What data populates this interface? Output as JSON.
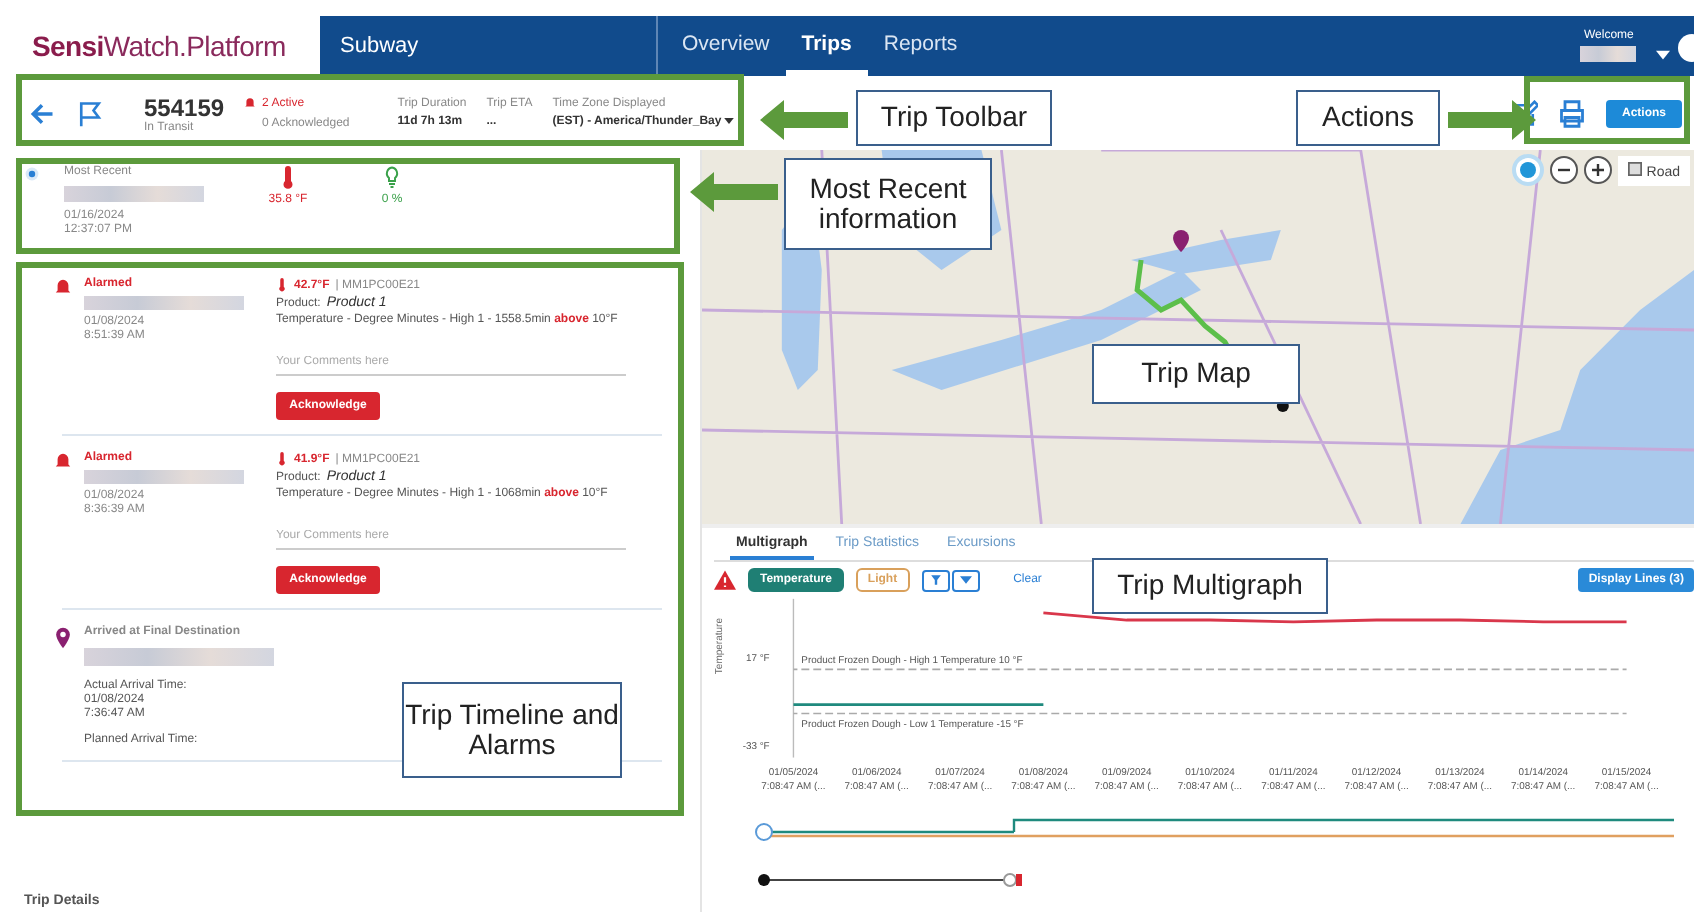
{
  "header": {
    "logo_bold": "Sensi",
    "logo_rest": "Watch.Platform",
    "account": "Subway",
    "nav": [
      {
        "label": "Overview",
        "selected": false
      },
      {
        "label": "Trips",
        "selected": true
      },
      {
        "label": "Reports",
        "selected": false
      }
    ],
    "welcome": "Welcome"
  },
  "toolbar": {
    "trip_id": "554159",
    "status": "In Transit",
    "active": "2 Active",
    "acknowledged": "0 Acknowledged",
    "fields": [
      {
        "label": "Trip Duration",
        "value": "11d 7h 13m"
      },
      {
        "label": "Trip ETA",
        "value": "..."
      }
    ],
    "timezone_label": "Time Zone Displayed",
    "timezone": "(EST) - America/Thunder_Bay",
    "actions": "Actions"
  },
  "most_recent": {
    "title": "Most Recent",
    "date": "01/16/2024",
    "time": "12:37:07 PM",
    "temperature": "35.8 °F",
    "light": "0 %"
  },
  "timeline": [
    {
      "kind": "alarm",
      "title": "Alarmed",
      "date": "01/08/2024",
      "time": "8:51:39 AM",
      "reading": "42.7°F",
      "sensor": "| MM1PC00E21",
      "product_label": "Product:",
      "product": "Product 1",
      "detail": "Temperature - Degree Minutes - High 1 - 1558.5min **above** 10°F",
      "placeholder": "Your Comments here",
      "button": "Acknowledge"
    },
    {
      "kind": "alarm",
      "title": "Alarmed",
      "date": "01/08/2024",
      "time": "8:36:39 AM",
      "reading": "41.9°F",
      "sensor": "| MM1PC00E21",
      "product_label": "Product:",
      "product": "Product 1",
      "detail": "Temperature - Degree Minutes - High 1 - 1068min **above** 10°F",
      "placeholder": "Your Comments here",
      "button": "Acknowledge"
    },
    {
      "kind": "arrival",
      "title": "Arrived at Final Destination",
      "actual_label": "Actual Arrival Time:",
      "date": "01/08/2024",
      "time": "7:36:47 AM",
      "planned_label": "Planned Arrival Time:"
    }
  ],
  "trip_details": "Trip Details",
  "map": {
    "layer": "Road"
  },
  "multigraph": {
    "tabs": [
      {
        "label": "Multigraph",
        "selected": true
      },
      {
        "label": "Trip Statistics",
        "selected": false
      },
      {
        "label": "Excursions",
        "selected": false
      }
    ],
    "filters": [
      {
        "label": "Temperature",
        "selected": true,
        "color": "#1f7f74"
      },
      {
        "label": "Light",
        "selected": false,
        "color": "#d9a05b"
      }
    ],
    "clear": "Clear",
    "display_lines": "Display Lines (3)",
    "chart_data": {
      "type": "line",
      "ylabel": "Temperature",
      "categories": [
        "01/05/2024 7:08:47 AM (...",
        "01/06/2024 7:08:47 AM (...",
        "01/07/2024 7:08:47 AM (...",
        "01/08/2024 7:08:47 AM (...",
        "01/09/2024 7:08:47 AM (...",
        "01/10/2024 7:08:47 AM (...",
        "01/11/2024 7:08:47 AM (...",
        "01/12/2024 7:08:47 AM (...",
        "01/13/2024 7:08:47 AM (...",
        "01/14/2024 7:08:47 AM (...",
        "01/15/2024 7:08:47 AM (..."
      ],
      "series": [
        {
          "color": "#1f8a7e",
          "values": [
            -10,
            -10,
            -10,
            -10,
            null,
            null,
            null,
            null,
            null,
            null,
            null
          ]
        },
        {
          "color": "#d9374b",
          "values": [
            null,
            null,
            null,
            42,
            38,
            38,
            37,
            38,
            38,
            37,
            37
          ]
        },
        {
          "name": "Product Frozen Dough - High 1 Temperature 10 °F",
          "color": "#aaaaaa",
          "line_style": "dashed",
          "values": [
            10,
            10,
            10,
            10,
            10,
            10,
            10,
            10,
            10,
            10,
            10
          ]
        },
        {
          "name": "Product Frozen Dough - Low 1 Temperature -15 °F",
          "color": "#aaaaaa",
          "line_style": "dashed",
          "values": [
            -15,
            -15,
            -15,
            -15,
            -15,
            -15,
            -15,
            -15,
            -15,
            -15,
            -15
          ]
        }
      ],
      "ylim": [
        -40,
        50
      ],
      "yticks": [
        {
          "value": 17,
          "label": "17 °F"
        },
        {
          "value": -33,
          "label": "-33 °F"
        }
      ]
    }
  },
  "callouts": [
    {
      "label": "Trip Toolbar",
      "kind": "leftarrow"
    },
    {
      "label": "Actions",
      "kind": "rightarrow"
    },
    {
      "label": "Most Recent information",
      "kind": "leftarrow"
    },
    {
      "label": "Trip Map",
      "kind": "plain"
    },
    {
      "label": "Trip Timeline and Alarms",
      "kind": "plain"
    },
    {
      "label": "Trip Multigraph",
      "kind": "plain"
    }
  ]
}
